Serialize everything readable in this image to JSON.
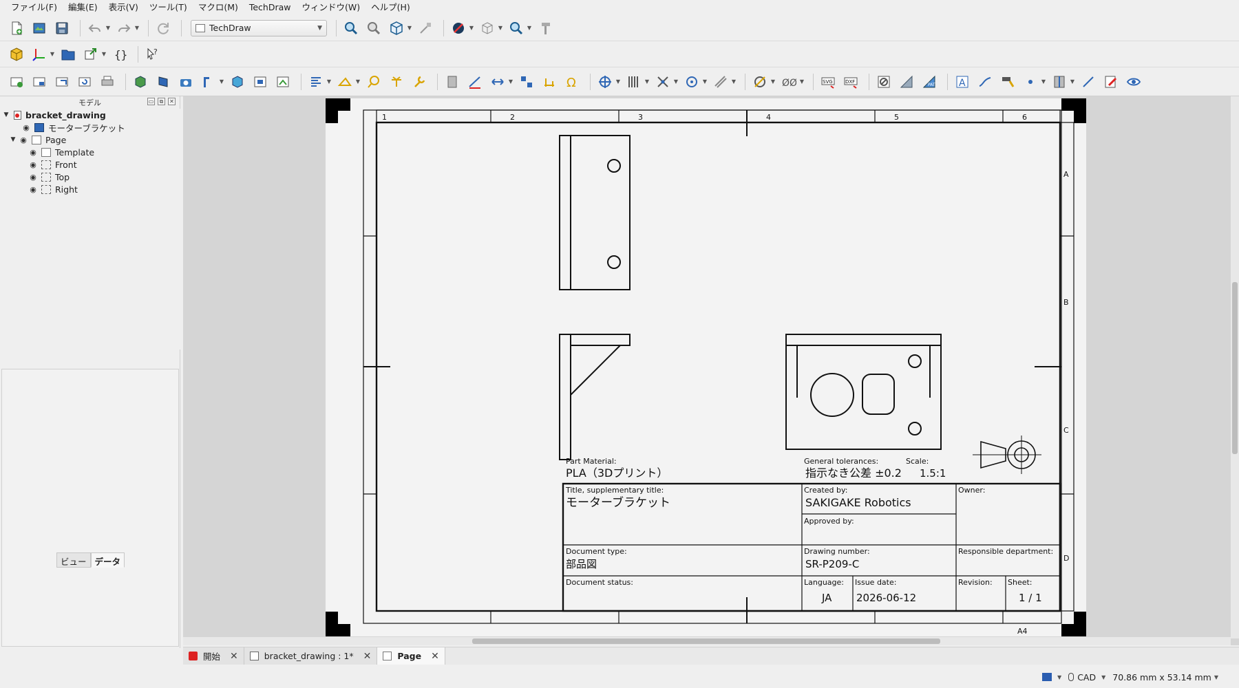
{
  "menubar": {
    "items": [
      "ファイル(F)",
      "編集(E)",
      "表示(V)",
      "ツール(T)",
      "マクロ(M)",
      "TechDraw",
      "ウィンドウ(W)",
      "ヘルプ(H)"
    ]
  },
  "toolbar": {
    "workbench": "TechDraw"
  },
  "model_panel": {
    "title": "モデル",
    "tree": [
      {
        "label": "bracket_drawing",
        "level": 0
      },
      {
        "label": "モーターブラケット",
        "level": 1
      },
      {
        "label": "Page",
        "level": 1
      },
      {
        "label": "Template",
        "level": 2
      },
      {
        "label": "Front",
        "level": 2
      },
      {
        "label": "Top",
        "level": 2
      },
      {
        "label": "Right",
        "level": 2
      }
    ],
    "tabs": [
      "ビュー",
      "データ"
    ],
    "active_tab": "データ"
  },
  "drawing": {
    "col_numbers": [
      "1",
      "2",
      "3",
      "4",
      "5",
      "6"
    ],
    "row_letters": [
      "A",
      "B",
      "C",
      "D"
    ],
    "part_material_label": "Part Material:",
    "part_material": "PLA（3Dプリント）",
    "general_tolerances_label": "General tolerances:",
    "general_tolerances": "指示なき公差 ±0.2",
    "scale_label": "Scale:",
    "scale": "1.5:1",
    "title_label": "Title, supplementary title:",
    "title": "モーターブラケット",
    "created_by_label": "Created by:",
    "created_by": "SAKIGAKE Robotics",
    "owner_label": "Owner:",
    "approved_by_label": "Approved by:",
    "document_type_label": "Document type:",
    "document_type": "部品図",
    "drawing_number_label": "Drawing number:",
    "drawing_number": "SR-P209-C",
    "responsible_department_label": "Responsible department:",
    "document_status_label": "Document status:",
    "language_label": "Language:",
    "language": "JA",
    "issue_date_label": "Issue date:",
    "issue_date": "2026-06-12",
    "revision_label": "Revision:",
    "sheet_label": "Sheet:",
    "sheet": "1 / 1",
    "paper_size": "A4"
  },
  "document_tabs": [
    {
      "label": "開始",
      "active": false
    },
    {
      "label": "bracket_drawing : 1*",
      "active": false
    },
    {
      "label": "Page",
      "active": true
    }
  ],
  "statusbar": {
    "navigation": "CAD",
    "dimensions": "70.86 mm x 53.14 mm"
  }
}
